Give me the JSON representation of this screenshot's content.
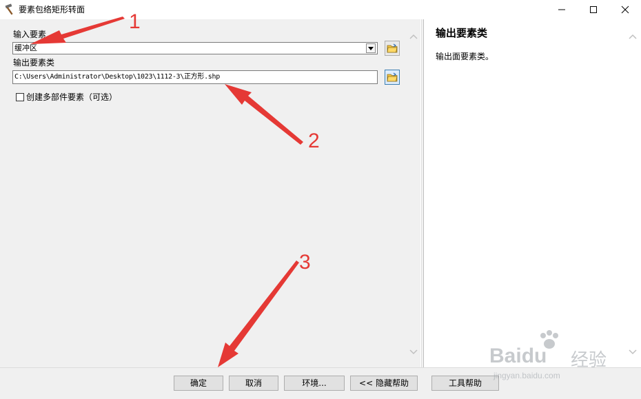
{
  "window": {
    "title": "要素包络矩形转面",
    "icon": "hammer-icon",
    "controls": [
      "minimize-icon",
      "maximize-icon",
      "close-icon"
    ]
  },
  "form": {
    "input_features": {
      "label": "输入要素",
      "value": "缓冲区",
      "icon": "browse-folder-icon"
    },
    "output_feature_class": {
      "label": "输出要素类",
      "value": "C:\\Users\\Administrator\\Desktop\\1023\\1112-3\\正方形.shp",
      "icon": "browse-folder-icon"
    },
    "multipart": {
      "label": "创建多部件要素（可选）",
      "checked": false
    }
  },
  "help_panel": {
    "title": "输出要素类",
    "description": "输出面要素类。"
  },
  "buttons": {
    "ok": "确定",
    "cancel": "取消",
    "environments": "环境...",
    "hide_help": "<< 隐藏帮助",
    "tool_help": "工具帮助"
  },
  "annotations": {
    "one": "1",
    "two": "2",
    "three": "3",
    "color": "#e53935"
  },
  "watermark": {
    "brand": "Bai",
    "brand2": "du",
    "cn": "经验",
    "url": "jingyan.baidu.com"
  },
  "colors": {
    "panel_bg": "#f0f0f0",
    "button_bg": "#e1e1e1",
    "active_border": "#3c7fb1",
    "arrow_red": "#e53935"
  }
}
